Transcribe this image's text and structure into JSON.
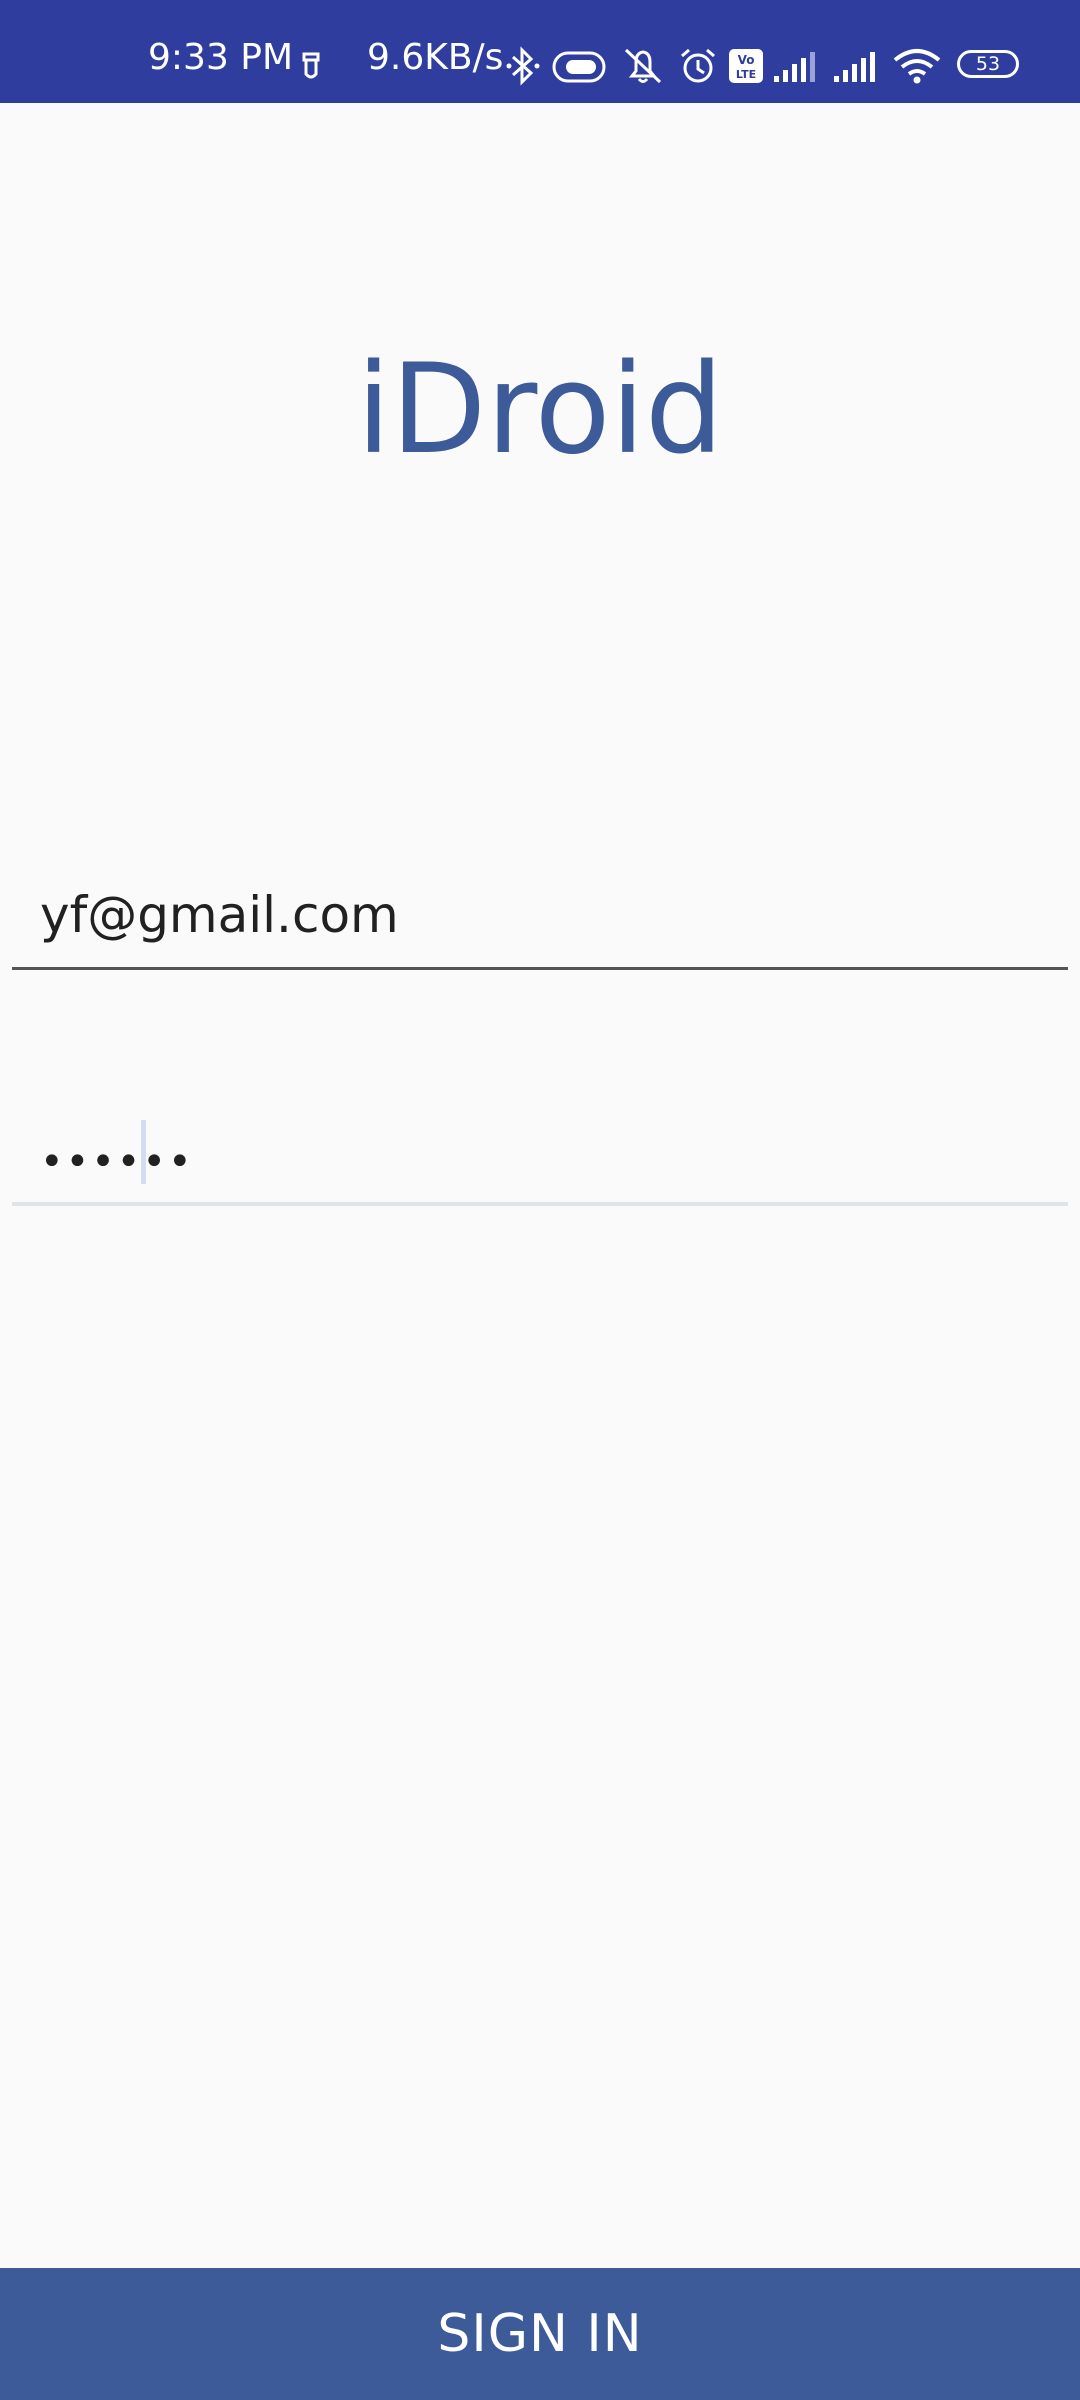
{
  "status_bar": {
    "time": "9:33 PM",
    "net_speed": "9.6KB/s",
    "battery": "53",
    "background_color": "#2f3e9e",
    "icons": [
      "sim-icon",
      "bluetooth-icon",
      "toggle-icon",
      "mute-icon",
      "alarm-icon",
      "volte-icon",
      "signal-icon",
      "signal-icon",
      "wifi-icon",
      "battery-icon"
    ]
  },
  "app": {
    "title": "iDroid",
    "title_color": "#3d5a99"
  },
  "form": {
    "email_value": "yf@gmail.com",
    "password_value": "••••••"
  },
  "actions": {
    "sign_in_label": "SIGN IN",
    "button_color": "#3d5a99"
  }
}
